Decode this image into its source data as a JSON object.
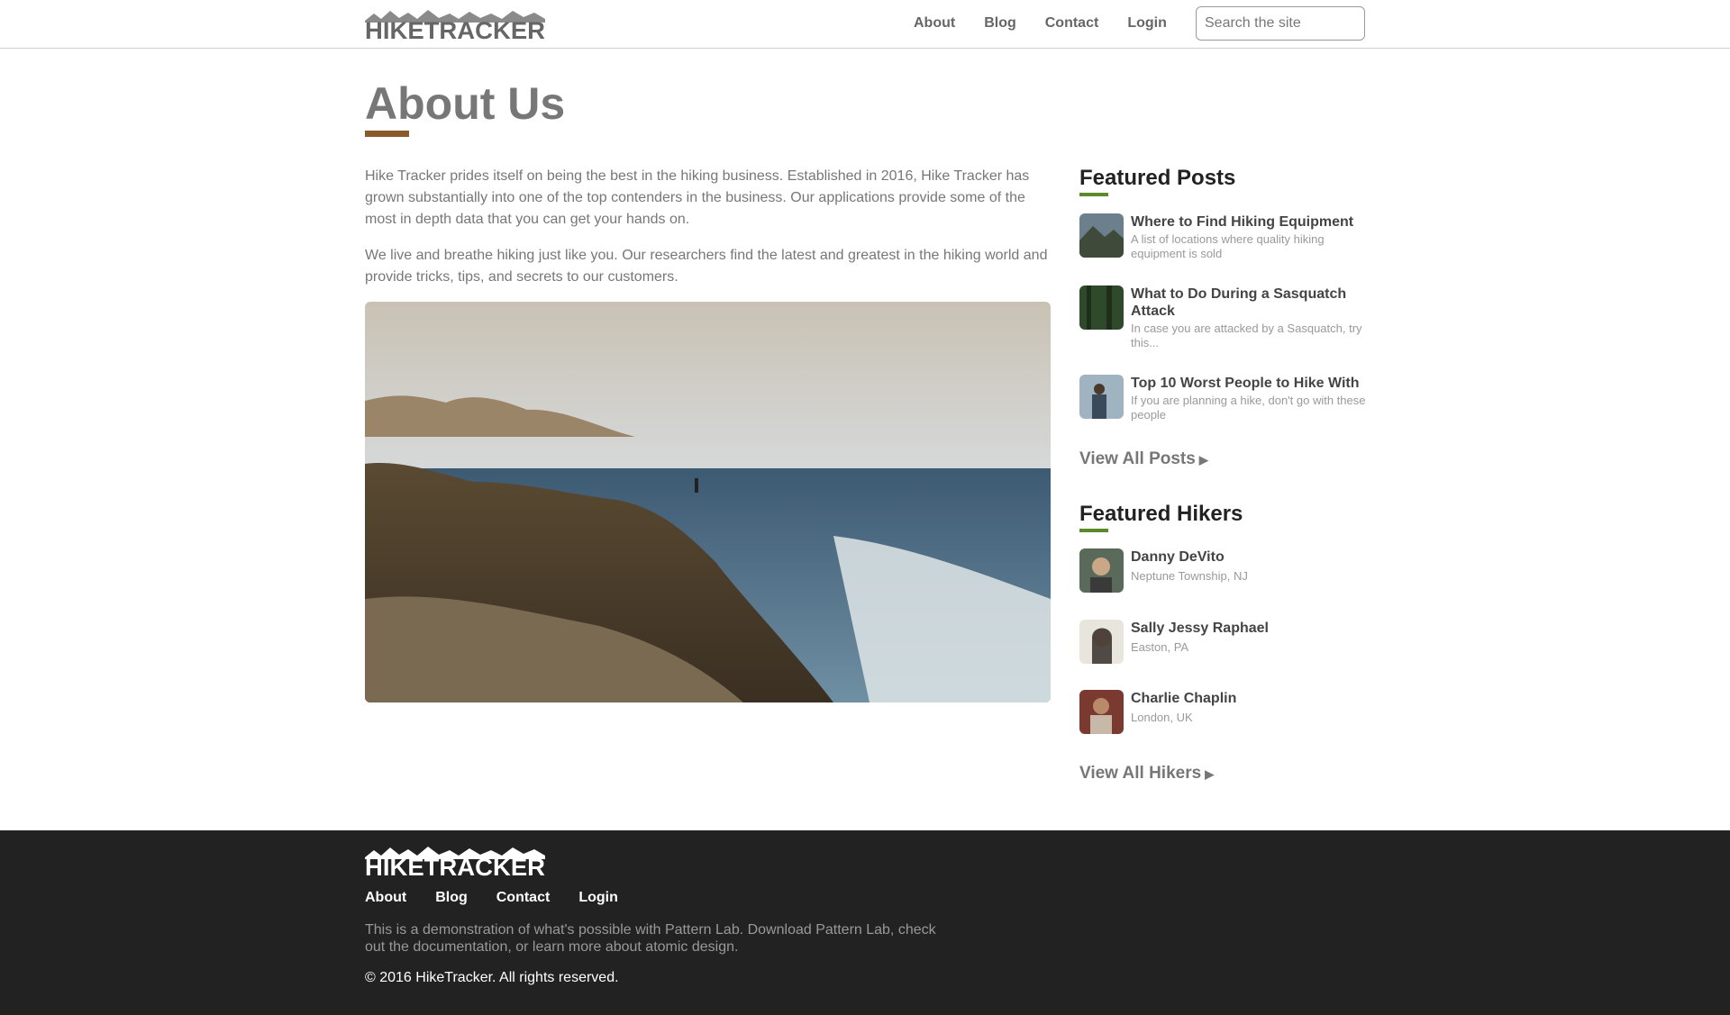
{
  "header": {
    "logo_text": "HIKETRACKER",
    "nav": [
      "About",
      "Blog",
      "Contact",
      "Login"
    ],
    "search_placeholder": "Search the site"
  },
  "main": {
    "title": "About Us",
    "paragraphs": [
      "Hike Tracker prides itself on being the best in the hiking business. Established in 2016, Hike Tracker has grown substantially into one of the top contenders in the business. Our applications provide some of the most in depth data that you can get your hands on.",
      "We live and breathe hiking just like you. Our researchers find the latest and greatest in the hiking world and provide tricks, tips, and secrets to our customers."
    ]
  },
  "sidebar": {
    "featured_posts_heading": "Featured Posts",
    "posts": [
      {
        "title": "Where to Find Hiking Equipment",
        "excerpt": "A list of locations where quality hiking equipment is sold"
      },
      {
        "title": "What to Do During a Sasquatch Attack",
        "excerpt": "In case you are attacked by a Sasquatch, try this..."
      },
      {
        "title": "Top 10 Worst People to Hike With",
        "excerpt": "If you are planning a hike, don't go with these people"
      }
    ],
    "view_all_posts": "View All Posts",
    "featured_hikers_heading": "Featured Hikers",
    "hikers": [
      {
        "name": "Danny DeVito",
        "location": "Neptune Township, NJ"
      },
      {
        "name": "Sally Jessy Raphael",
        "location": "Easton, PA"
      },
      {
        "name": "Charlie Chaplin",
        "location": "London, UK"
      }
    ],
    "view_all_hikers": "View All Hikers",
    "arrow_icon": "▶"
  },
  "footer": {
    "logo_text": "HIKETRACKER",
    "nav": [
      "About",
      "Blog",
      "Contact",
      "Login"
    ],
    "description": "This is a demonstration of what's possible with Pattern Lab. Download Pattern Lab, check out the documentation, or learn more about atomic design.",
    "copyright": "© 2016 HikeTracker. All rights reserved."
  },
  "colors": {
    "title_accent": "#8b5a2b",
    "sidebar_accent": "#5a8a2b",
    "footer_bg": "#222222"
  }
}
